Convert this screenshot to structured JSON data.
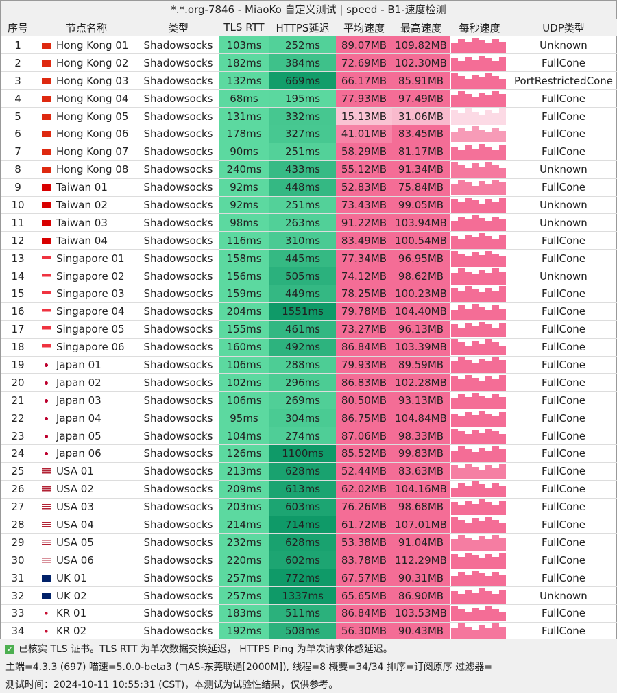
{
  "title": "*.*.org-7846 - MiaoKo 自定义测试 | speed - B1-速度检测",
  "headers": [
    "序号",
    "节点名称",
    "类型",
    "TLS RTT",
    "HTTPS延迟",
    "平均速度",
    "最高速度",
    "每秒速度",
    "UDP类型"
  ],
  "rows": [
    [
      "1",
      "hk",
      "Hong Kong 01",
      "Shadowsocks",
      "103ms",
      "252ms",
      "89.07MB",
      "109.82MB",
      "Unknown"
    ],
    [
      "2",
      "hk",
      "Hong Kong 02",
      "Shadowsocks",
      "182ms",
      "384ms",
      "72.69MB",
      "102.30MB",
      "FullCone"
    ],
    [
      "3",
      "hk",
      "Hong Kong 03",
      "Shadowsocks",
      "132ms",
      "669ms",
      "66.17MB",
      "85.91MB",
      "PortRestrictedCone"
    ],
    [
      "4",
      "hk",
      "Hong Kong 04",
      "Shadowsocks",
      "68ms",
      "195ms",
      "77.93MB",
      "97.49MB",
      "FullCone"
    ],
    [
      "5",
      "hk",
      "Hong Kong 05",
      "Shadowsocks",
      "131ms",
      "332ms",
      "15.13MB",
      "31.06MB",
      "FullCone"
    ],
    [
      "6",
      "hk",
      "Hong Kong 06",
      "Shadowsocks",
      "178ms",
      "327ms",
      "41.01MB",
      "83.45MB",
      "FullCone"
    ],
    [
      "7",
      "hk",
      "Hong Kong 07",
      "Shadowsocks",
      "90ms",
      "251ms",
      "58.29MB",
      "81.17MB",
      "FullCone"
    ],
    [
      "8",
      "hk",
      "Hong Kong 08",
      "Shadowsocks",
      "240ms",
      "433ms",
      "55.12MB",
      "91.34MB",
      "Unknown"
    ],
    [
      "9",
      "tw",
      "Taiwan 01",
      "Shadowsocks",
      "92ms",
      "448ms",
      "52.83MB",
      "75.84MB",
      "FullCone"
    ],
    [
      "10",
      "tw",
      "Taiwan 02",
      "Shadowsocks",
      "92ms",
      "251ms",
      "73.43MB",
      "99.05MB",
      "Unknown"
    ],
    [
      "11",
      "tw",
      "Taiwan 03",
      "Shadowsocks",
      "98ms",
      "263ms",
      "91.22MB",
      "103.94MB",
      "Unknown"
    ],
    [
      "12",
      "tw",
      "Taiwan 04",
      "Shadowsocks",
      "116ms",
      "310ms",
      "83.49MB",
      "100.54MB",
      "FullCone"
    ],
    [
      "13",
      "sg",
      "Singapore 01",
      "Shadowsocks",
      "158ms",
      "445ms",
      "77.34MB",
      "96.95MB",
      "FullCone"
    ],
    [
      "14",
      "sg",
      "Singapore 02",
      "Shadowsocks",
      "156ms",
      "505ms",
      "74.12MB",
      "98.62MB",
      "Unknown"
    ],
    [
      "15",
      "sg",
      "Singapore 03",
      "Shadowsocks",
      "159ms",
      "449ms",
      "78.25MB",
      "100.23MB",
      "FullCone"
    ],
    [
      "16",
      "sg",
      "Singapore 04",
      "Shadowsocks",
      "204ms",
      "1551ms",
      "79.78MB",
      "104.40MB",
      "FullCone"
    ],
    [
      "17",
      "sg",
      "Singapore 05",
      "Shadowsocks",
      "155ms",
      "461ms",
      "73.27MB",
      "96.13MB",
      "FullCone"
    ],
    [
      "18",
      "sg",
      "Singapore 06",
      "Shadowsocks",
      "160ms",
      "492ms",
      "86.84MB",
      "103.39MB",
      "FullCone"
    ],
    [
      "19",
      "jp",
      "Japan 01",
      "Shadowsocks",
      "106ms",
      "288ms",
      "79.93MB",
      "89.59MB",
      "FullCone"
    ],
    [
      "20",
      "jp",
      "Japan 02",
      "Shadowsocks",
      "102ms",
      "296ms",
      "86.83MB",
      "102.28MB",
      "FullCone"
    ],
    [
      "21",
      "jp",
      "Japan 03",
      "Shadowsocks",
      "106ms",
      "269ms",
      "80.50MB",
      "93.13MB",
      "FullCone"
    ],
    [
      "22",
      "jp",
      "Japan 04",
      "Shadowsocks",
      "95ms",
      "304ms",
      "86.75MB",
      "104.84MB",
      "FullCone"
    ],
    [
      "23",
      "jp",
      "Japan 05",
      "Shadowsocks",
      "104ms",
      "274ms",
      "87.06MB",
      "98.33MB",
      "FullCone"
    ],
    [
      "24",
      "jp",
      "Japan 06",
      "Shadowsocks",
      "126ms",
      "1100ms",
      "85.52MB",
      "99.83MB",
      "FullCone"
    ],
    [
      "25",
      "us",
      "USA 01",
      "Shadowsocks",
      "213ms",
      "628ms",
      "52.44MB",
      "83.63MB",
      "FullCone"
    ],
    [
      "26",
      "us",
      "USA 02",
      "Shadowsocks",
      "209ms",
      "613ms",
      "62.02MB",
      "104.16MB",
      "FullCone"
    ],
    [
      "27",
      "us",
      "USA 03",
      "Shadowsocks",
      "203ms",
      "603ms",
      "76.26MB",
      "98.68MB",
      "FullCone"
    ],
    [
      "28",
      "us",
      "USA 04",
      "Shadowsocks",
      "214ms",
      "714ms",
      "61.72MB",
      "107.01MB",
      "FullCone"
    ],
    [
      "29",
      "us",
      "USA 05",
      "Shadowsocks",
      "232ms",
      "628ms",
      "53.38MB",
      "91.04MB",
      "FullCone"
    ],
    [
      "30",
      "us",
      "USA 06",
      "Shadowsocks",
      "220ms",
      "602ms",
      "83.78MB",
      "112.29MB",
      "FullCone"
    ],
    [
      "31",
      "uk",
      "UK 01",
      "Shadowsocks",
      "257ms",
      "772ms",
      "67.57MB",
      "90.31MB",
      "FullCone"
    ],
    [
      "32",
      "uk",
      "UK 02",
      "Shadowsocks",
      "257ms",
      "1337ms",
      "65.65MB",
      "86.90MB",
      "Unknown"
    ],
    [
      "33",
      "kr",
      "KR 01",
      "Shadowsocks",
      "183ms",
      "511ms",
      "86.84MB",
      "103.53MB",
      "FullCone"
    ],
    [
      "34",
      "kr",
      "KR 02",
      "Shadowsocks",
      "192ms",
      "508ms",
      "56.30MB",
      "90.43MB",
      "FullCone"
    ]
  ],
  "footer": {
    "line1": "已核实 TLS 证书。TLS RTT 为单次数据交换延迟， HTTPS Ping 为单次请求体感延迟。",
    "line2": "主端=4.3.3 (697) 喵速=5.0.0-beta3 (□AS-东莞联通[2000M]), 线程=8 概要=34/34 排序=订阅原序 过滤器=",
    "line3": "测试时间：2024-10-11 10:55:31 (CST)，本测试为试验性结果，仅供参考。"
  },
  "colors": {
    "tls": "#5cd9a0",
    "https_low": "#5cd9a0",
    "https_high": "#0f9a68",
    "speed": "#f46d96",
    "speed_low": "#fbd0dc"
  }
}
